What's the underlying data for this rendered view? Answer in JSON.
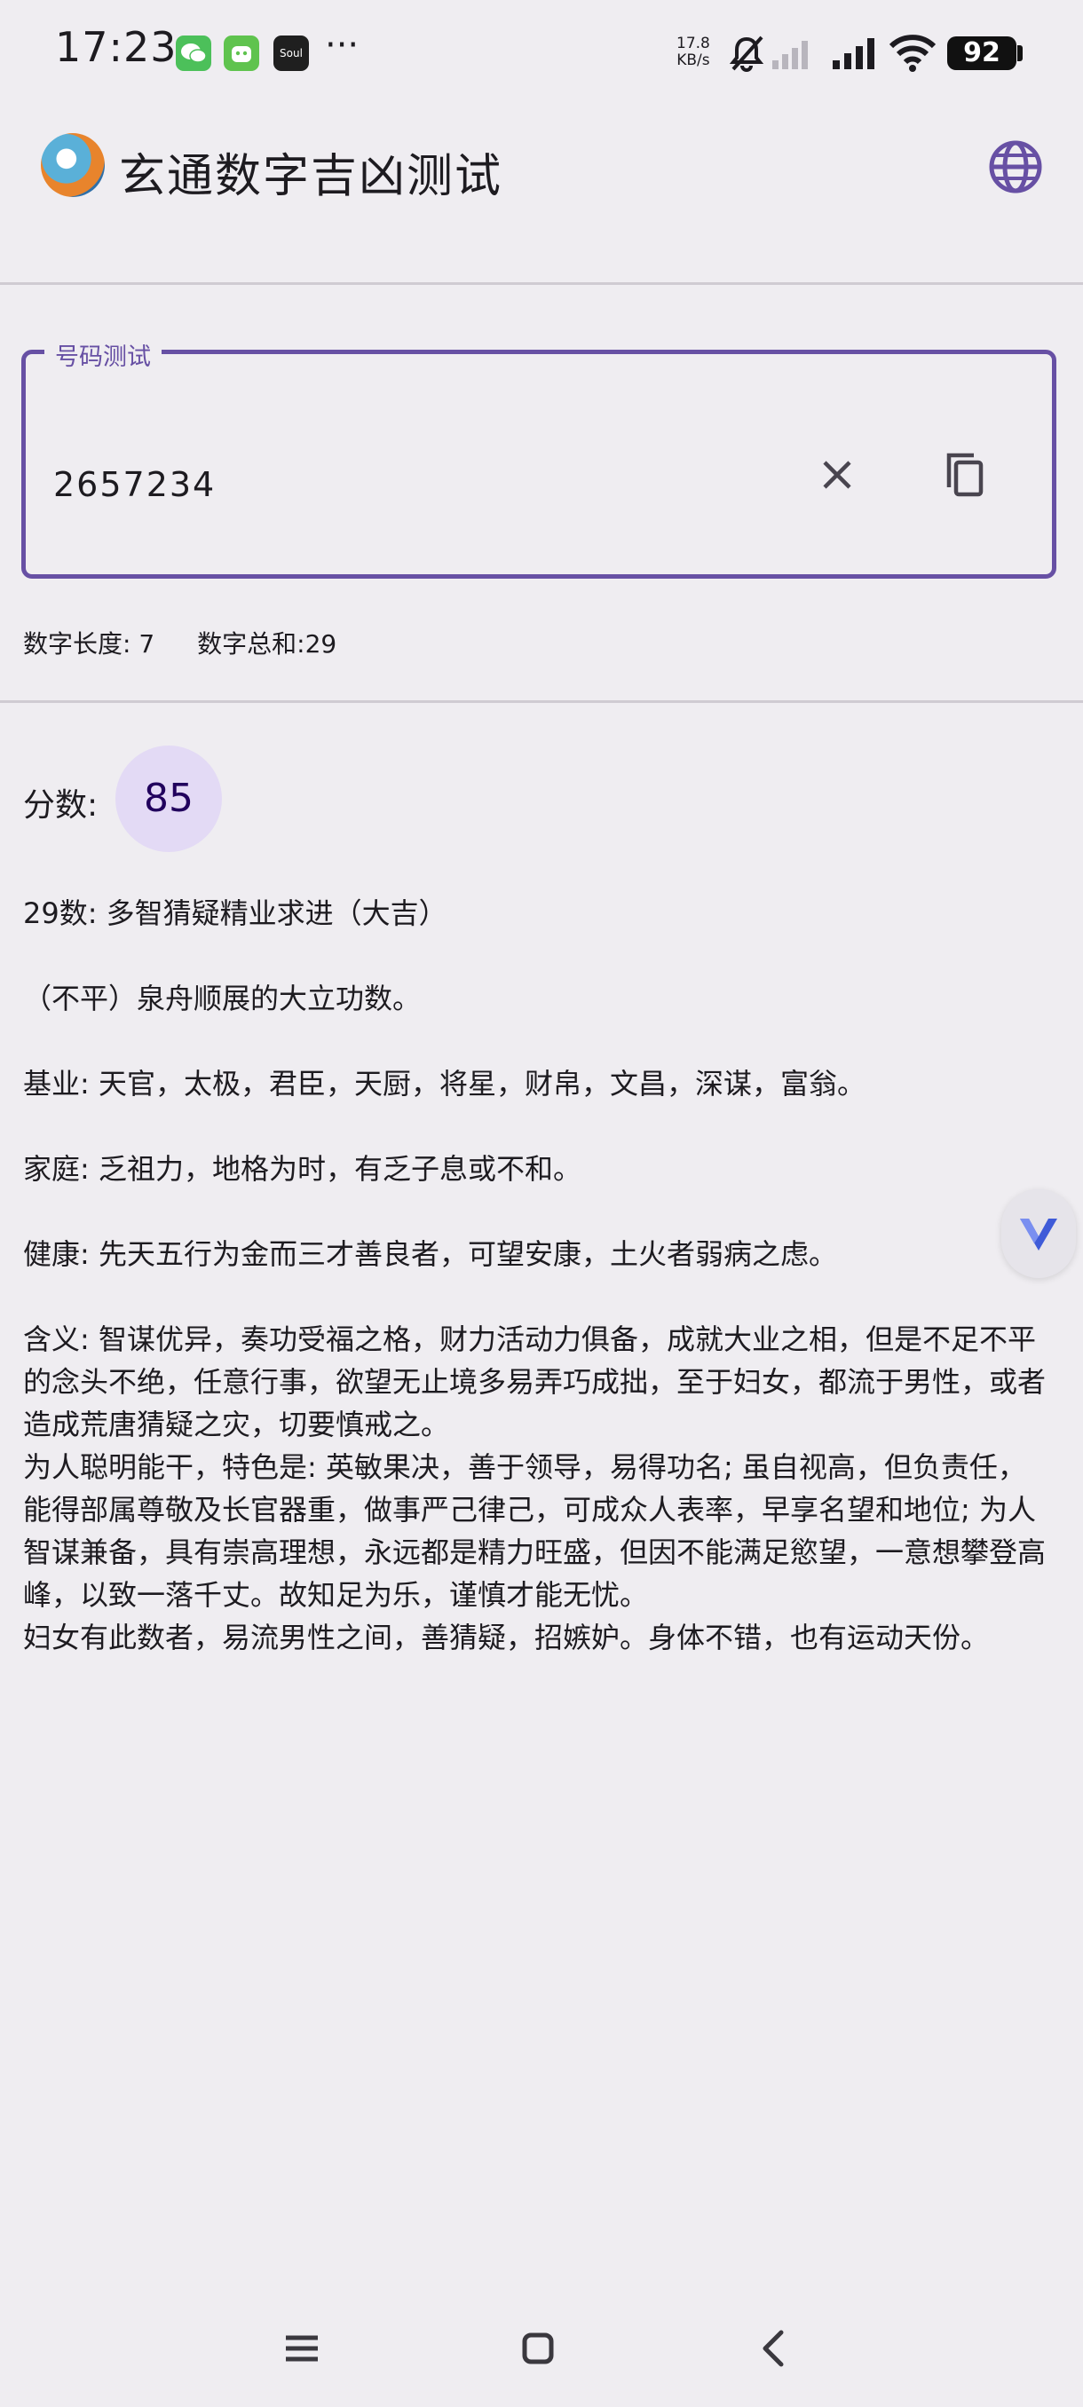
{
  "status_bar": {
    "time": "17:23",
    "network_speed_value": "17.8",
    "network_speed_unit": "KB/s",
    "battery": "92",
    "icons": [
      "wechat-icon",
      "app-icon",
      "soul-icon",
      "more-dots",
      "bell-muted-icon",
      "signal-weak-icon",
      "signal-icon",
      "wifi-icon",
      "battery-icon"
    ],
    "soul_label": "Soul"
  },
  "app_bar": {
    "title": "玄通数字吉凶测试"
  },
  "input": {
    "label": "号码测试",
    "value": "2657234"
  },
  "stats": {
    "length": "数字长度: 7",
    "sum": "数字总和:29"
  },
  "score": {
    "label": "分数:",
    "value": "85"
  },
  "content": {
    "heading": "29数: 多智猜疑精业求进（大吉）",
    "summary": "（不平）泉舟顺展的大立功数。",
    "foundation": "基业: 天官，太极，君臣，天厨，将星，财帛，文昌，深谋，富翁。",
    "family": "家庭: 乏祖力，地格为时，有乏子息或不和。",
    "health": "健康: 先天五行为金而三才善良者，可望安康，土火者弱病之虑。",
    "meaning": "含义: 智谋优异，奏功受福之格，财力活动力俱备，成就大业之相，但是不足不平的念头不绝，任意行事，欲望无止境多易弄巧成拙，至于妇女，都流于男性，或者造成荒唐猜疑之灾，切要慎戒之。",
    "character": "为人聪明能干，特色是: 英敏果决，善于领导，易得功名; 虽自视高，但负责任，能得部属尊敬及长官器重，做事严己律己，可成众人表率，早享名望和地位; 为人智谋兼备，具有崇高理想，永远都是精力旺盛，但因不能满足慾望，一意想攀登高峰，以致一落千丈。故知足为乐，谨慎才能无忧。",
    "women": "妇女有此数者，易流男性之间，善猜疑，招嫉妒。身体不错，也有运动天份。"
  },
  "colors": {
    "primary": "#6750a4",
    "score_bubble": "#e3daf5",
    "background": "#efedf1"
  }
}
